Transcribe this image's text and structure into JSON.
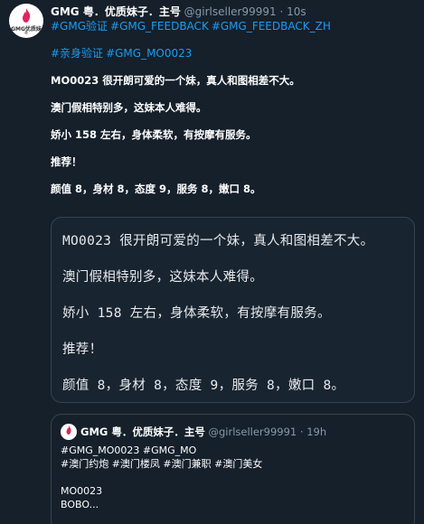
{
  "tweet": {
    "avatar": {
      "icon": "flame-logo",
      "text": "GMG优质妹",
      "sub": "粤",
      "accent": "#e0245e"
    },
    "author": "GMG 粤．优质妹子．主号",
    "handle": "@girlseller99991",
    "separator": "·",
    "time": "10s",
    "hashtags_line1": [
      "#GMG验证",
      "#GMG_FEEDBACK",
      "#GMG_FEEDBACK_ZH"
    ],
    "hashtags_line2": [
      "#亲身验证",
      "#GMG_MO0023"
    ],
    "paragraphs": [
      "MO0023 很开朗可爱的一个妹，真人和图相差不大。",
      "澳门假相特别多，这妹本人难得。",
      "娇小 158 左右，身体柔软，有按摩有服务。",
      "推荐！",
      "颜值 8，身材 8，态度 9，服务 8，嫩口 8。"
    ]
  },
  "image_card": {
    "lines": [
      "MO0023 很开朗可爱的一个妹，真人和图相差不大。",
      "澳门假相特别多，这妹本人难得。",
      "娇小 158 左右，身体柔软，有按摩有服务。",
      "推荐！",
      "颜值 8，身材 8，态度 9，服务 8，嫩口 8。"
    ]
  },
  "quoted_tweet": {
    "avatar_icon": "flame-logo",
    "author": "GMG 粤．优质妹子．主号",
    "handle": "@girlseller99991",
    "separator": "·",
    "time": "19h",
    "line1": "#GMG_MO0023 #GMG_MO",
    "line2": "#澳门约炮 #澳门楼凤 #澳门兼职 #澳门美女",
    "line3": "MO0023",
    "line4": "BOBO..."
  },
  "colors": {
    "background": "#15202b",
    "link": "#1d9bf0",
    "muted": "#8899a6",
    "border": "#38444d"
  }
}
